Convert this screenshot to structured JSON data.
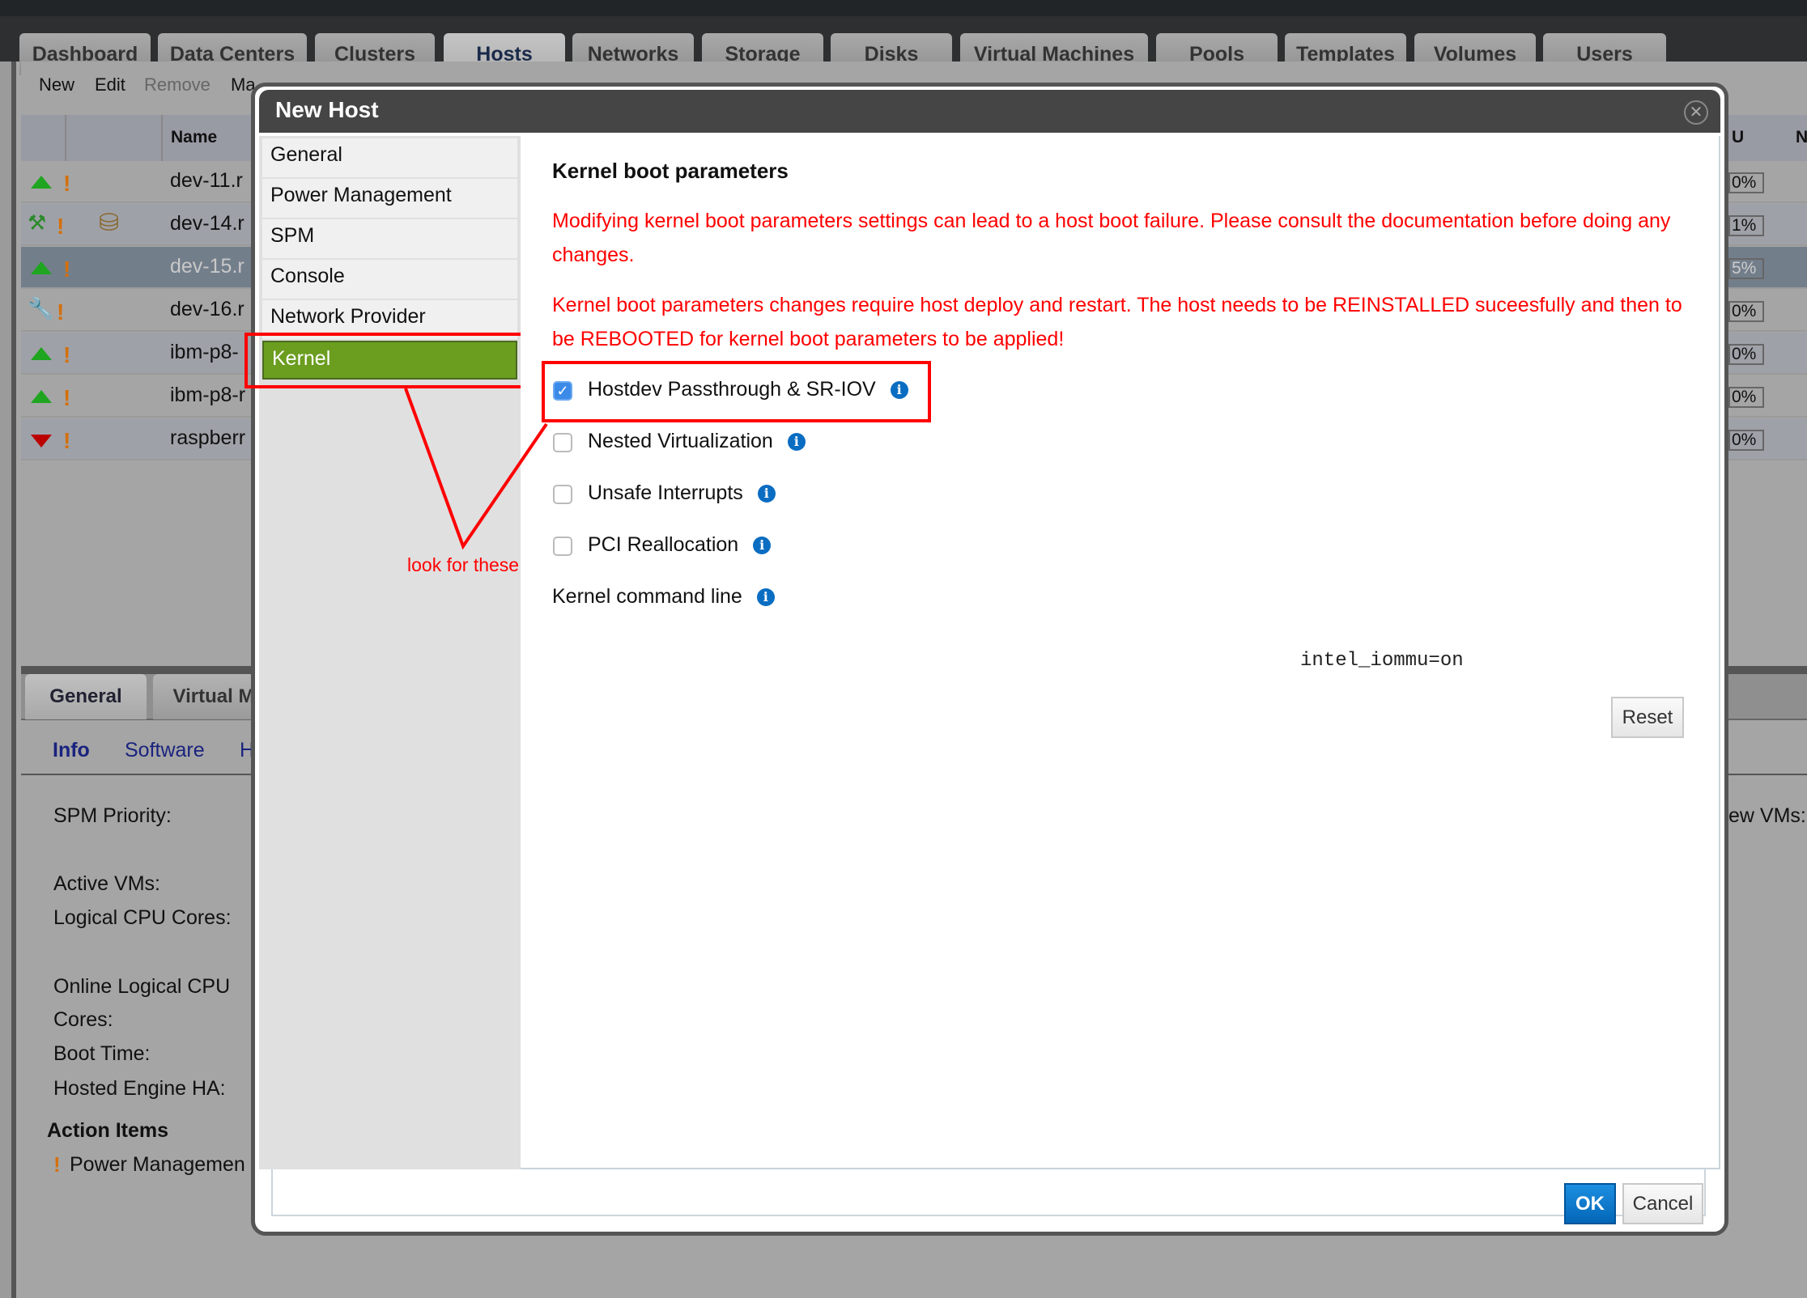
{
  "main_tabs": [
    {
      "label": "Dashboard"
    },
    {
      "label": "Data Centers"
    },
    {
      "label": "Clusters"
    },
    {
      "label": "Hosts",
      "active": true
    },
    {
      "label": "Networks"
    },
    {
      "label": "Storage"
    },
    {
      "label": "Disks"
    },
    {
      "label": "Virtual Machines"
    },
    {
      "label": "Pools"
    },
    {
      "label": "Templates"
    },
    {
      "label": "Volumes"
    },
    {
      "label": "Users"
    }
  ],
  "toolbar": {
    "new": "New",
    "edit": "Edit",
    "remove": "Remove",
    "more": "Ma"
  },
  "grid": {
    "header_name": "Name",
    "header_partial_right": "U",
    "header_partial_far": "N",
    "rows": [
      {
        "name": "dev-11.r",
        "status": "up",
        "pct": "0%"
      },
      {
        "name": "dev-14.r",
        "status": "maintenance-up",
        "pct": "1%"
      },
      {
        "name": "dev-15.r",
        "status": "up",
        "pct": "5%",
        "selected": true
      },
      {
        "name": "dev-16.r",
        "status": "maintenance",
        "pct": "0%"
      },
      {
        "name": "ibm-p8-",
        "status": "up",
        "pct": "0%"
      },
      {
        "name": "ibm-p8-r",
        "status": "up",
        "pct": "0%"
      },
      {
        "name": "raspberr",
        "status": "down",
        "pct": "0%"
      }
    ]
  },
  "detail": {
    "tabs": [
      "General",
      "Virtual M"
    ],
    "subtabs": [
      "Info",
      "Software",
      "H"
    ],
    "labels": [
      "SPM Priority:",
      "Active VMs:",
      "Logical CPU Cores:",
      "Online Logical CPU",
      "Cores:",
      "Boot Time:",
      "Hosted Engine HA:"
    ],
    "action_items_title": "Action Items",
    "action_item": "Power Managemen",
    "right_label": "ew VMs:"
  },
  "dialog": {
    "title": "New Host",
    "nav": [
      "General",
      "Power Management",
      "SPM",
      "Console",
      "Network Provider",
      "Kernel"
    ],
    "active_nav": "Kernel",
    "section_title": "Kernel boot parameters",
    "warning1": "Modifying kernel boot parameters settings can lead to a host boot failure. Please consult the documentation before doing any changes.",
    "warning2": "Kernel boot parameters changes require host deploy and restart. The host needs to be REINSTALLED suceesfully and then to be REBOOTED for kernel boot parameters to be applied!",
    "options": [
      {
        "label": "Hostdev Passthrough & SR-IOV",
        "checked": true
      },
      {
        "label": "Nested Virtualization",
        "checked": false
      },
      {
        "label": "Unsafe Interrupts",
        "checked": false
      },
      {
        "label": "PCI Reallocation",
        "checked": false
      }
    ],
    "cmdline_label": "Kernel command line",
    "cmdline_value": "intel_iommu=on",
    "reset": "Reset",
    "ok": "OK",
    "cancel": "Cancel"
  },
  "annotation": {
    "text": "look for these",
    "color": "#ff0000"
  },
  "colors": {
    "accent_green": "#6b9d1f",
    "ok_blue": "#0a6dc2",
    "warning_red": "#ff0000"
  }
}
